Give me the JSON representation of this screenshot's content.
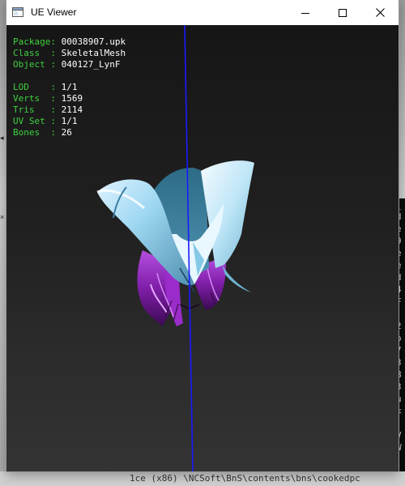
{
  "window": {
    "title": "UE Viewer",
    "controls": {
      "minimize": "minimize-icon",
      "maximize": "maximize-icon",
      "close": "close-icon"
    }
  },
  "info": {
    "rows_top": [
      {
        "label": "Package: ",
        "value": "00038907.upk"
      },
      {
        "label": "Class  : ",
        "value": "SkeletalMesh"
      },
      {
        "label": "Object : ",
        "value": "040127_LynF"
      }
    ],
    "rows_bottom": [
      {
        "label": "LOD    : ",
        "value": "1/1"
      },
      {
        "label": "Verts  : ",
        "value": "1569"
      },
      {
        "label": "Tris   : ",
        "value": "2114"
      },
      {
        "label": "UV Set : ",
        "value": "1/1"
      },
      {
        "label": "Bones  : ",
        "value": "26"
      }
    ]
  },
  "background_terminal": {
    "lines": [
      "_",
      "d",
      "e",
      "9",
      "e",
      "e",
      "d",
      "4",
      "F",
      "",
      "2",
      "o",
      "7",
      "3",
      "B",
      "3",
      "u",
      "<",
      "",
      "V",
      "W"
    ]
  },
  "background_strip": {
    "text": "1ce  (x86) \\NCSoft\\BnS\\contents\\bns\\cookedpc"
  },
  "colors": {
    "label_green": "#3fd13f",
    "value_white": "#ffffff",
    "axis_blue": "#1a1aff",
    "hair_purple": "#8a1fb0"
  }
}
